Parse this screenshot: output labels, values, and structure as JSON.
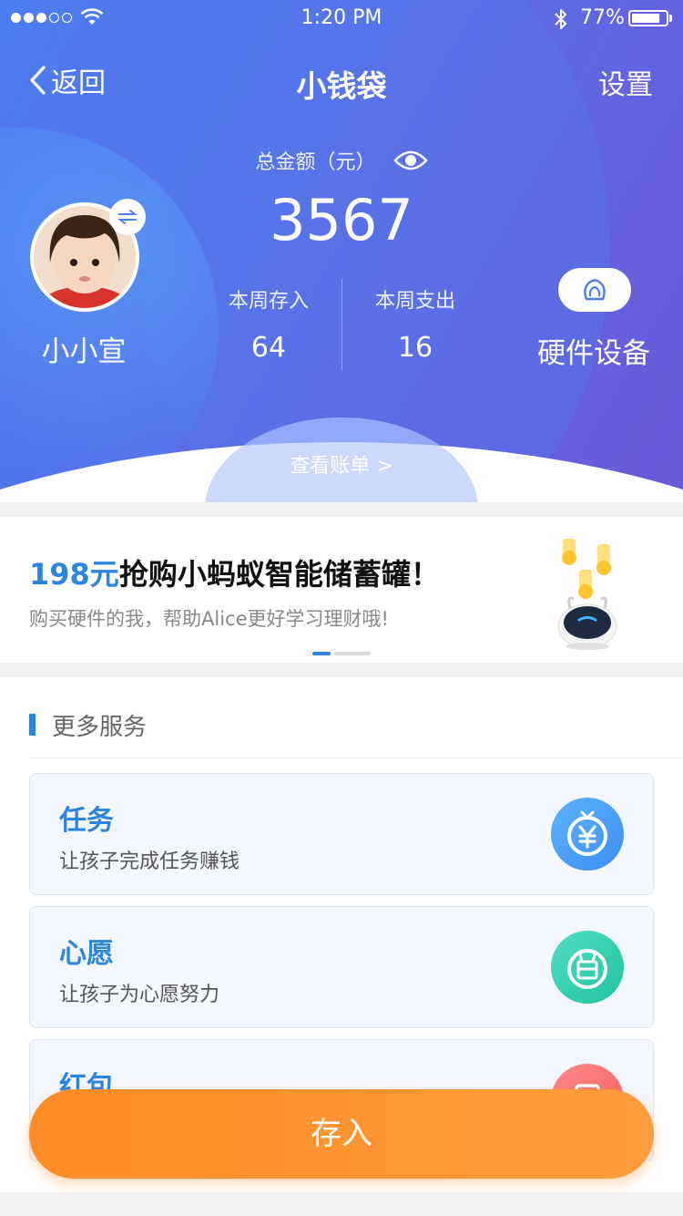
{
  "status_bar": {
    "time": "1:20 PM",
    "battery": "77%"
  },
  "nav": {
    "back_label": "返回",
    "title": "小钱袋",
    "settings_label": "设置"
  },
  "account": {
    "total_label": "总金额（元）",
    "total_amount": "3567",
    "child_name": "小小宣",
    "weekly_in_label": "本周存入",
    "weekly_in_value": "64",
    "weekly_out_label": "本周支出",
    "weekly_out_value": "16",
    "device_label": "硬件设备",
    "bill_link": "查看账单 >"
  },
  "banner": {
    "price": "198元",
    "title_rest": "抢购小蚂蚁智能储蓄罐！",
    "subtitle": "购买硬件的我，帮助Alice更好学习理财哦!",
    "page_count": 2,
    "active_page": 1
  },
  "services": {
    "heading": "更多服务",
    "items": [
      {
        "title": "任务",
        "desc": "让孩子完成任务赚钱",
        "icon": "yuan-coin-icon",
        "color": "#3f9bf3"
      },
      {
        "title": "心愿",
        "desc": "让孩子为心愿努力",
        "icon": "gift-icon",
        "color": "#2fcfae"
      },
      {
        "title": "红包",
        "desc": "",
        "icon": "red-packet-icon",
        "color": "#f86a6a"
      }
    ]
  },
  "deposit_button": "存入",
  "colors": {
    "accent": "#2b85e0",
    "hero_start": "#4a7ef0",
    "hero_end": "#6a58d8",
    "deposit": "#ff8c26"
  }
}
